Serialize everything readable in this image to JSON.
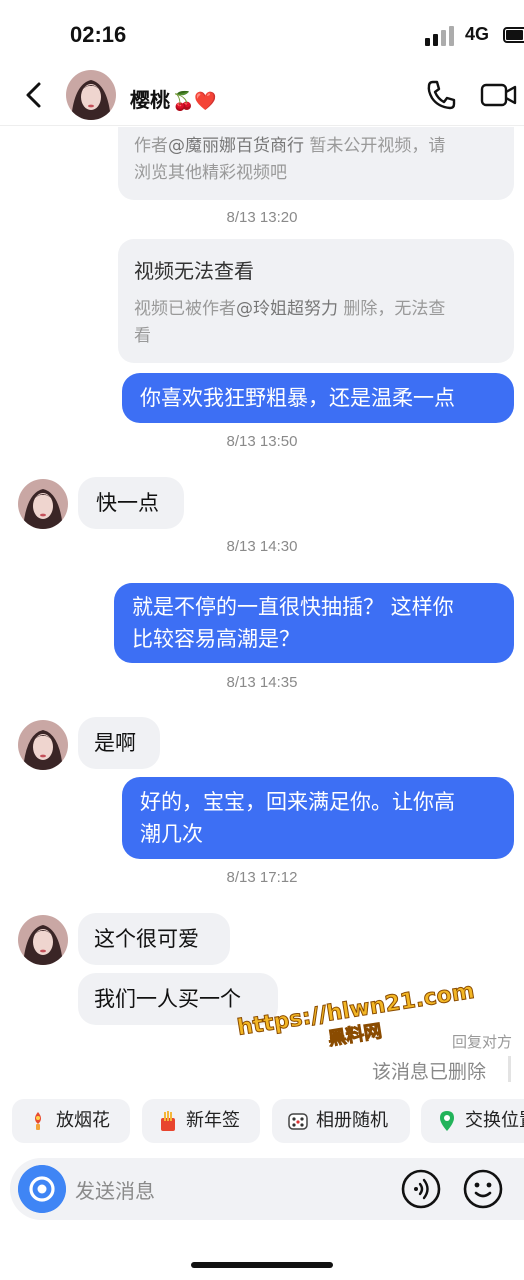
{
  "status_bar": {
    "time": "02:16",
    "network": "4G"
  },
  "header": {
    "contact_name": "樱桃",
    "contact_emoji": "🍒❤️"
  },
  "messages": {
    "card1": {
      "desc_prefix": "作者",
      "author": "@魔丽娜百货商行",
      "desc_suffix": " 暂未公开视频，请",
      "desc_line2": "浏览其他精彩视频吧"
    },
    "ts1": "8/13 13:20",
    "card2": {
      "title": "视频无法查看",
      "desc_prefix": "视频已被作者",
      "author": "@玲姐超努力",
      "desc_suffix": " 删除，无法查",
      "desc_line2": "看"
    },
    "out1": "你喜欢我狂野粗暴，还是温柔一点",
    "ts2": "8/13 13:50",
    "in1": "快一点",
    "ts3": "8/13 14:30",
    "out2_line1": "就是不停的一直很快抽插？ 这样你",
    "out2_line2": "比较容易高潮是？",
    "ts4": "8/13 14:35",
    "in2": "是啊",
    "out3_line1": "好的，宝宝，回来满足你。让你高",
    "out3_line2": "潮几次",
    "ts5": "8/13 17:12",
    "in3": "这个很可爱",
    "in4": "我们一人买一个",
    "reply_label": "回复对方",
    "deleted": "该消息已删除"
  },
  "watermark": {
    "url": "https://hlwn21.com",
    "cn": "黑料网"
  },
  "quick_actions": [
    {
      "label": "放烟花",
      "icon": "firework-icon"
    },
    {
      "label": "新年签",
      "icon": "fortune-icon"
    },
    {
      "label": "相册随机",
      "icon": "dice-icon"
    },
    {
      "label": "交换位置",
      "icon": "location-pin-icon"
    }
  ],
  "input": {
    "placeholder": "发送消息"
  },
  "colors": {
    "outgoing_bubble": "#3d6ff4",
    "incoming_bubble": "#f0f1f4",
    "camera_button": "#3f85f5"
  }
}
